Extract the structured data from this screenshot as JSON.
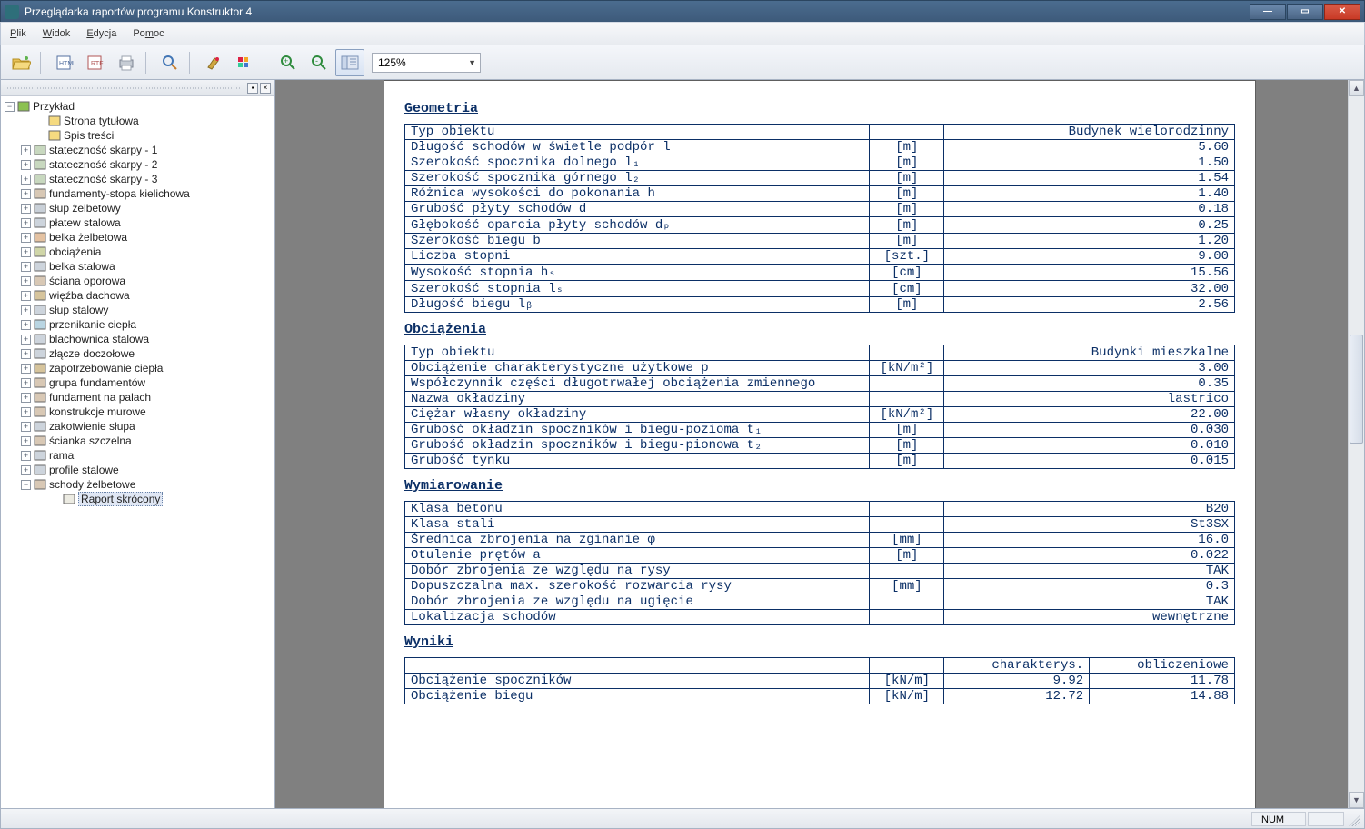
{
  "window": {
    "title": "Przeglądarka raportów programu Konstruktor 4"
  },
  "menu": {
    "file": "Plik",
    "view": "Widok",
    "edit": "Edycja",
    "help": "Pomoc"
  },
  "toolbar": {
    "zoom_value": "125%"
  },
  "tree": {
    "root": "Przykład",
    "nodes": [
      {
        "label": "Strona tytułowa",
        "leaf": true,
        "indent": 2
      },
      {
        "label": "Spis treści",
        "leaf": true,
        "indent": 2
      },
      {
        "label": "stateczność skarpy - 1",
        "leaf": false,
        "indent": 1
      },
      {
        "label": "stateczność skarpy - 2",
        "leaf": false,
        "indent": 1
      },
      {
        "label": "stateczność skarpy - 3",
        "leaf": false,
        "indent": 1
      },
      {
        "label": "fundamenty-stopa kielichowa",
        "leaf": false,
        "indent": 1
      },
      {
        "label": "słup żelbetowy",
        "leaf": false,
        "indent": 1
      },
      {
        "label": "płatew stalowa",
        "leaf": false,
        "indent": 1
      },
      {
        "label": "belka żelbetowa",
        "leaf": false,
        "indent": 1
      },
      {
        "label": "obciążenia",
        "leaf": false,
        "indent": 1
      },
      {
        "label": "belka stalowa",
        "leaf": false,
        "indent": 1
      },
      {
        "label": "ściana oporowa",
        "leaf": false,
        "indent": 1
      },
      {
        "label": "więźba dachowa",
        "leaf": false,
        "indent": 1
      },
      {
        "label": "słup stalowy",
        "leaf": false,
        "indent": 1
      },
      {
        "label": "przenikanie ciepła",
        "leaf": false,
        "indent": 1
      },
      {
        "label": "blachownica stalowa",
        "leaf": false,
        "indent": 1
      },
      {
        "label": "złącze doczołowe",
        "leaf": false,
        "indent": 1
      },
      {
        "label": "zapotrzebowanie ciepła",
        "leaf": false,
        "indent": 1
      },
      {
        "label": "grupa fundamentów",
        "leaf": false,
        "indent": 1
      },
      {
        "label": "fundament na palach",
        "leaf": false,
        "indent": 1
      },
      {
        "label": "konstrukcje murowe",
        "leaf": false,
        "indent": 1
      },
      {
        "label": "zakotwienie słupa",
        "leaf": false,
        "indent": 1
      },
      {
        "label": "ścianka szczelna",
        "leaf": false,
        "indent": 1
      },
      {
        "label": "rama",
        "leaf": false,
        "indent": 1
      },
      {
        "label": "profile stalowe",
        "leaf": false,
        "indent": 1
      },
      {
        "label": "schody żelbetowe",
        "leaf": false,
        "indent": 1,
        "expanded": true
      },
      {
        "label": "Raport skrócony",
        "leaf": true,
        "indent": 3,
        "selected": true
      }
    ]
  },
  "report": {
    "sections": {
      "geometria": "Geometria",
      "obciazenia": "Obciążenia",
      "wymiarowanie": "Wymiarowanie",
      "wyniki": "Wyniki"
    },
    "geometria_rows": [
      {
        "label": "Typ obiektu",
        "unit": "",
        "value": "Budynek wielorodzinny"
      },
      {
        "label": "Długość schodów w świetle podpór l",
        "unit": "[m]",
        "value": "5.60"
      },
      {
        "label": "Szerokość spocznika dolnego l₁",
        "unit": "[m]",
        "value": "1.50"
      },
      {
        "label": "Szerokość spocznika górnego l₂",
        "unit": "[m]",
        "value": "1.54"
      },
      {
        "label": "Różnica wysokości do pokonania h",
        "unit": "[m]",
        "value": "1.40"
      },
      {
        "label": "Grubość płyty schodów d",
        "unit": "[m]",
        "value": "0.18"
      },
      {
        "label": "Głębokość oparcia płyty schodów dₚ",
        "unit": "[m]",
        "value": "0.25"
      },
      {
        "label": "Szerokość biegu b",
        "unit": "[m]",
        "value": "1.20"
      },
      {
        "label": "Liczba stopni",
        "unit": "[szt.]",
        "value": "9.00"
      },
      {
        "label": "Wysokość stopnia hₛ",
        "unit": "[cm]",
        "value": "15.56"
      },
      {
        "label": "Szerokość stopnia lₛ",
        "unit": "[cm]",
        "value": "32.00"
      },
      {
        "label": "Długość biegu lᵦ",
        "unit": "[m]",
        "value": "2.56"
      }
    ],
    "obciazenia_rows": [
      {
        "label": "Typ obiektu",
        "unit": "",
        "value": "Budynki mieszkalne"
      },
      {
        "label": "Obciążenie charakterystyczne użytkowe p",
        "unit": "[kN/m²]",
        "value": "3.00"
      },
      {
        "label": "Współczynnik części długotrwałej obciążenia zmiennego",
        "unit": "",
        "value": "0.35"
      },
      {
        "label": "Nazwa okładziny",
        "unit": "",
        "value": "lastrico"
      },
      {
        "label": "Ciężar własny okładziny",
        "unit": "[kN/m²]",
        "value": "22.00"
      },
      {
        "label": "Grubość okładzin spoczników i biegu-pozioma t₁",
        "unit": "[m]",
        "value": "0.030"
      },
      {
        "label": "Grubość okładzin spoczników i biegu-pionowa t₂",
        "unit": "[m]",
        "value": "0.010"
      },
      {
        "label": "Grubość tynku",
        "unit": "[m]",
        "value": "0.015"
      }
    ],
    "wymiarowanie_rows": [
      {
        "label": "Klasa betonu",
        "unit": "",
        "value": "B20"
      },
      {
        "label": "Klasa stali",
        "unit": "",
        "value": "St3SX"
      },
      {
        "label": "Średnica zbrojenia na zginanie φ",
        "unit": "[mm]",
        "value": "16.0"
      },
      {
        "label": "Otulenie prętów a",
        "unit": "[m]",
        "value": "0.022"
      },
      {
        "label": "Dobór zbrojenia ze względu na rysy",
        "unit": "",
        "value": "TAK"
      },
      {
        "label": "Dopuszczalna max. szerokość rozwarcia rysy",
        "unit": "[mm]",
        "value": "0.3"
      },
      {
        "label": "Dobór zbrojenia ze względu na ugięcie",
        "unit": "",
        "value": "TAK"
      },
      {
        "label": "Lokalizacja schodów",
        "unit": "",
        "value": "wewnętrzne"
      }
    ],
    "wyniki_header": {
      "c3": "charakterys.",
      "c4": "obliczeniowe"
    },
    "wyniki_rows": [
      {
        "label": "Obciążenie spoczników",
        "unit": "[kN/m]",
        "v1": "9.92",
        "v2": "11.78"
      },
      {
        "label": "Obciążenie biegu",
        "unit": "[kN/m]",
        "v1": "12.72",
        "v2": "14.88"
      }
    ]
  },
  "status": {
    "num": "NUM"
  }
}
